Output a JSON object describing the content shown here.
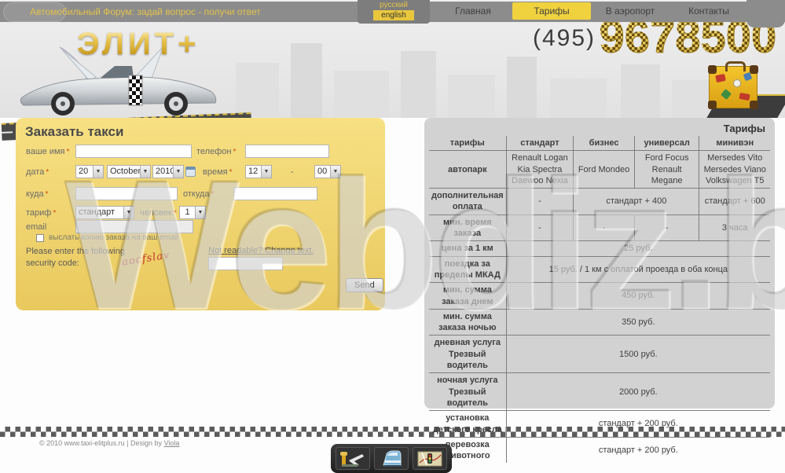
{
  "top_bar": {
    "forum_link": "Автомобильный Форум: задай вопрос - получи ответ",
    "lang": {
      "russian": "русский",
      "english": "english"
    },
    "nav": [
      {
        "name": "home",
        "label": "Главная",
        "active": false
      },
      {
        "name": "tariffs",
        "label": "Тарифы",
        "active": true
      },
      {
        "name": "airport",
        "label": "В аэропорт",
        "active": false
      },
      {
        "name": "contacts",
        "label": "Контакты",
        "active": false
      }
    ]
  },
  "header": {
    "logo_text": "ЭЛИТ+",
    "phone_code": "(495)",
    "phone_number": "9678500"
  },
  "order_form": {
    "title": "Заказать такси",
    "required_mark": "*",
    "name_label": "ваше имя",
    "phone_label": "телефон",
    "date_label": "дата",
    "time_label": "время",
    "to_label": "куда",
    "from_label": "откуда",
    "tariff_label": "тариф",
    "persons_label": "человек",
    "email_label": "email",
    "date": {
      "day": "20",
      "month": "October",
      "year": "2010"
    },
    "time": {
      "hour": "12",
      "separator": "-",
      "minute": "00"
    },
    "tariff_value": "стандарт",
    "persons_value": "1",
    "copy_checkbox_label": "выслать копию заказа на ваш email",
    "captcha": {
      "prompt": "Please enter the following security code:",
      "code": "aocfslav",
      "change_link": "Not readable? Change text.",
      "send_label": "Send"
    }
  },
  "tariffs": {
    "title": "Тарифы",
    "columns": [
      "тарифы",
      "стандарт",
      "бизнес",
      "универсал",
      "минивэн"
    ],
    "rows": [
      {
        "label": "автопарк",
        "cells": [
          {
            "text": "Renault Logan\nKia Spectra\nDaewoo Nexia"
          },
          {
            "text": "Ford Mondeo"
          },
          {
            "text": "Ford Focus\nRenault Megane"
          },
          {
            "text": "Mersedes Vito\nMersedes Viano\nVolkswagen T5"
          }
        ]
      },
      {
        "label": "дополнительная\nоплата",
        "cells": [
          {
            "text": "-"
          },
          {
            "text": "стандарт + 400",
            "span": 2
          },
          {
            "text": "стандарт + 600"
          }
        ]
      },
      {
        "label": "мин. время\nзаказа",
        "cells": [
          {
            "text": "-"
          },
          {
            "text": "-"
          },
          {
            "text": "-"
          },
          {
            "text": "3 часа"
          }
        ]
      },
      {
        "label": "цена за 1 км",
        "cells": [
          {
            "text": "25 руб.",
            "span": 4
          }
        ]
      },
      {
        "label": "поездка за\nпределы МКАД",
        "cells": [
          {
            "text": "15 руб. / 1 км с оплатой проезда в оба конца",
            "span": 4
          }
        ]
      },
      {
        "label": "мин. сумма\nзаказа днем",
        "cells": [
          {
            "text": "450 руб.",
            "span": 4
          }
        ]
      },
      {
        "label": "мин. сумма\nзаказа ночью",
        "cells": [
          {
            "text": "350 руб.",
            "span": 4
          }
        ]
      },
      {
        "label": "дневная услуга\nТрезвый\nводитель",
        "cells": [
          {
            "text": "1500 руб.",
            "span": 4
          }
        ]
      },
      {
        "label": "ночная услуга\nТрезвый\nводитель",
        "cells": [
          {
            "text": "2000 руб.",
            "span": 4
          }
        ]
      },
      {
        "label": "установка\nдетского кресла",
        "cells": [
          {
            "text": "стандарт + 200 руб.",
            "span": 4
          }
        ]
      },
      {
        "label": "перевозка\nживотного",
        "cells": [
          {
            "text": "стандарт + 200 руб.",
            "span": 4
          }
        ]
      }
    ]
  },
  "footer": {
    "copyright": "© 2010 www.taxi-elitplus.ru | Design by",
    "design_link": "Viola"
  },
  "watermark": "Webdiz.biz",
  "bottom_icons": [
    "airport-transfer-icon",
    "train-station-icon",
    "city-map-icon"
  ],
  "colors": {
    "accent_yellow": "#f0d23e",
    "gold": "#d4a017",
    "bar_gray": "#8c8c8c",
    "panel_gray": "#d2d2d2",
    "form_yellow": "#f0d36a"
  }
}
